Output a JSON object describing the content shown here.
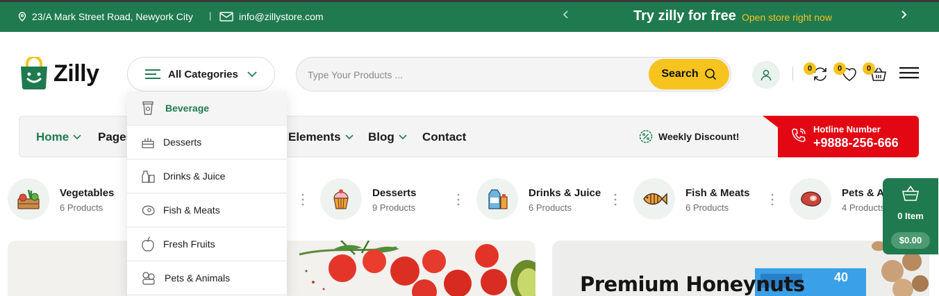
{
  "topbar": {
    "address": "23/A Mark Street Road, Newyork City",
    "separator": "|",
    "email": "info@zillystore.com",
    "promo_title": "Try zilly for free",
    "promo_link": "Open store right now"
  },
  "header": {
    "logo_text": "Zilly",
    "categories_label": "All Categories",
    "search_placeholder": "Type Your Products ...",
    "search_button": "Search",
    "compare_count": "0",
    "wishlist_count": "0",
    "cart_count": "0"
  },
  "nav": {
    "items": [
      {
        "label": "Home"
      },
      {
        "label": "Pages"
      },
      {
        "label": "Elements"
      },
      {
        "label": "Blog"
      },
      {
        "label": "Contact"
      }
    ],
    "weekly_discount": "Weekly Discount!",
    "hotline_label": "Hotline Number",
    "hotline_number": "+9888-256-666"
  },
  "dropdown": {
    "items": [
      {
        "label": "Beverage"
      },
      {
        "label": "Desserts"
      },
      {
        "label": "Drinks & Juice"
      },
      {
        "label": "Fish & Meats"
      },
      {
        "label": "Fresh Fruits"
      },
      {
        "label": "Pets & Animals"
      }
    ]
  },
  "categories": [
    {
      "title": "Vegetables",
      "count": "6 Products"
    },
    {
      "title": "Desserts",
      "count": "9 Products"
    },
    {
      "title": "Drinks & Juice",
      "count": "6 Products"
    },
    {
      "title": "Fish & Meats",
      "count": "6 Products"
    },
    {
      "title": "Pets & Animals",
      "count": "4 Products"
    }
  ],
  "cart_widget": {
    "items": "0 Item",
    "total": "$0.00"
  },
  "banners": {
    "second_title": "Premium Honeynuts",
    "package_label": "40"
  },
  "colors": {
    "brand_green": "#1f7a4f",
    "accent_yellow": "#f7c31e",
    "hotline_red": "#e30613"
  }
}
